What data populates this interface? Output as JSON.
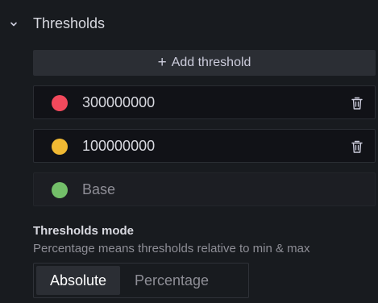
{
  "section": {
    "title": "Thresholds",
    "chevron_icon": "chevron-down-icon"
  },
  "add_button": {
    "label": "Add threshold",
    "icon": "plus-icon"
  },
  "thresholds": [
    {
      "value": "300000000",
      "color": "#f2495c",
      "deletable": true
    },
    {
      "value": "100000000",
      "color": "#fade2a",
      "deletable": true
    },
    {
      "label": "Base",
      "color": "#73bf69",
      "deletable": false
    }
  ],
  "mode": {
    "label": "Thresholds mode",
    "description": "Percentage means thresholds relative to min & max",
    "options": [
      "Absolute",
      "Percentage"
    ],
    "selected": "Absolute"
  },
  "colors": {
    "panel_bg": "#181b1f",
    "input_bg": "#111217",
    "button_bg": "#2b2e34",
    "text_primary": "#d8d9e0",
    "text_secondary": "#8e8e96"
  }
}
